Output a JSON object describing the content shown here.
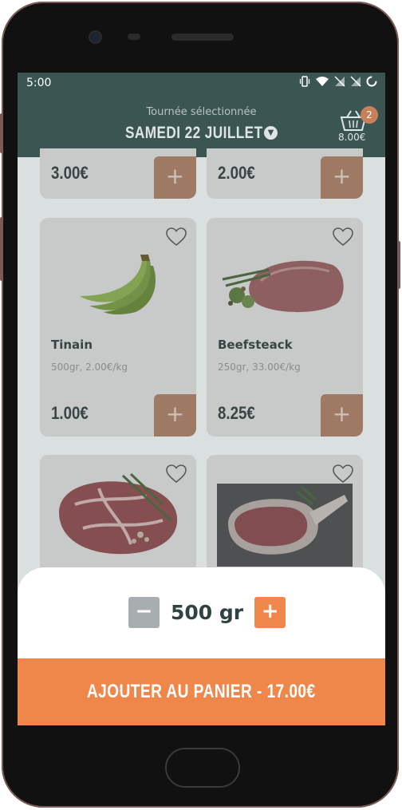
{
  "status_bar": {
    "time": "5:00"
  },
  "header": {
    "subtitle": "Tournée sélectionnée",
    "title": "SAMEDI 22 JUILLET",
    "cart_count": "2",
    "cart_amount": "8.00€"
  },
  "products_top_row": [
    {
      "price": "3.00€"
    },
    {
      "price": "2.00€"
    }
  ],
  "products": [
    {
      "name": "Tinain",
      "desc": "500gr, 2.00€/kg",
      "price": "1.00€"
    },
    {
      "name": "Beefsteack",
      "desc": "250gr, 33.00€/kg",
      "price": "8.25€"
    }
  ],
  "quantity_sheet": {
    "minus_label": "−",
    "plus_label": "+",
    "quantity": "500 gr",
    "add_to_cart_label": "AJOUTER AU PANIER - 17.00€"
  },
  "add_button_label": "+",
  "colors": {
    "header_bg": "#3b5553",
    "accent": "#f0874a",
    "minus_bg": "#a8aeb0"
  }
}
